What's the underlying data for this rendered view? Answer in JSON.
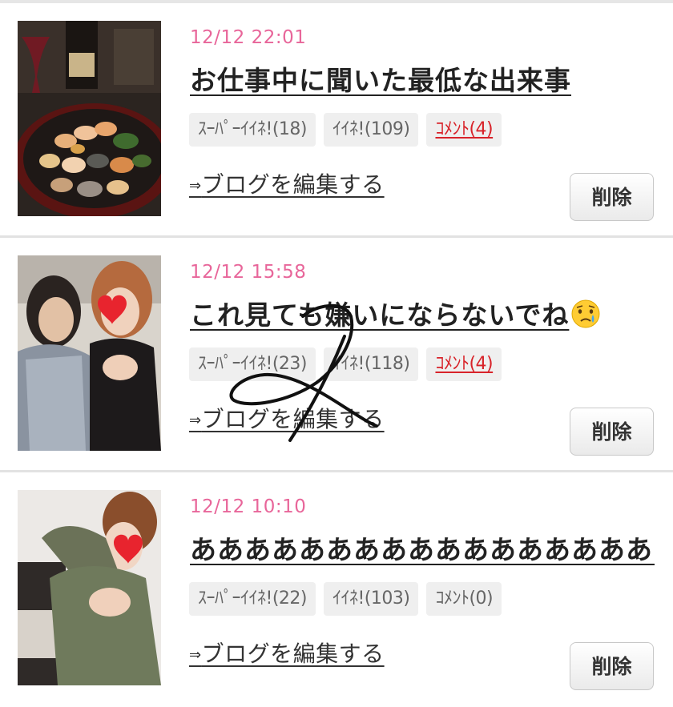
{
  "posts": [
    {
      "date": "12/12 22:01",
      "title": "お仕事中に聞いた最低な出来事",
      "super_like_label": "ｽｰﾊﾟｰｲｲﾈ!(18)",
      "like_label": "ｲｲﾈ!(109)",
      "comment_label": "ｺﾒﾝﾄ(4)",
      "edit_label": "ブログを編集する",
      "delete_label": "削除"
    },
    {
      "date": "12/12 15:58",
      "title": "これ見ても嫌いにならないでね",
      "super_like_label": "ｽｰﾊﾟｰｲｲﾈ!(23)",
      "like_label": "ｲｲﾈ!(118)",
      "comment_label": "ｺﾒﾝﾄ(4)",
      "edit_label": "ブログを編集する",
      "delete_label": "削除"
    },
    {
      "date": "12/12 10:10",
      "title": "あああああああああああああああああ…",
      "super_like_label": "ｽｰﾊﾟｰｲｲﾈ!(22)",
      "like_label": "ｲｲﾈ!(103)",
      "comment_label": "ｺﾒﾝﾄ(0)",
      "edit_label": "ブログを編集する",
      "delete_label": "削除"
    }
  ],
  "icons": {
    "title_emoji_post_2": "crying-face-icon",
    "edit_arrow": "arrow-right-icon"
  },
  "colors": {
    "date": "#e8669a",
    "comment_active": "#d8232a",
    "badge_bg": "#efefef"
  },
  "edit_arrow_glyph": "⇒"
}
